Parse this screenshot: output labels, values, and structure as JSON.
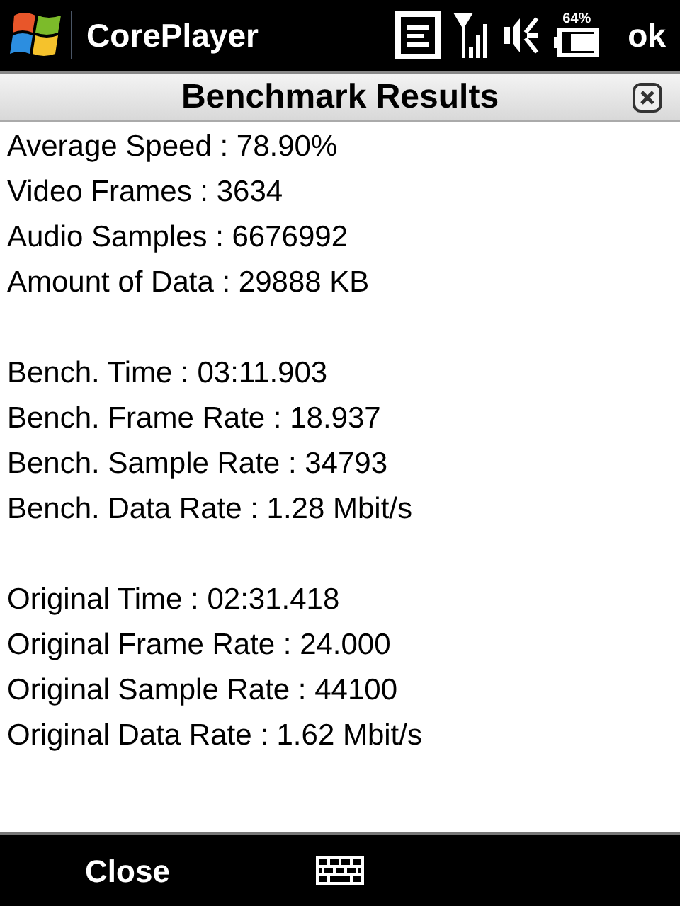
{
  "status_bar": {
    "app_title": "CorePlayer",
    "battery_label": "64%",
    "ok_button": "ok"
  },
  "dialog": {
    "title": "Benchmark Results"
  },
  "groups": [
    {
      "lines": [
        "Average Speed : 78.90%",
        "Video Frames : 3634",
        "Audio Samples : 6676992",
        "Amount of Data : 29888 KB"
      ]
    },
    {
      "lines": [
        "Bench. Time : 03:11.903",
        "Bench. Frame Rate : 18.937",
        "Bench. Sample Rate : 34793",
        "Bench. Data Rate : 1.28 Mbit/s"
      ]
    },
    {
      "lines": [
        "Original Time : 02:31.418",
        "Original Frame Rate : 24.000",
        "Original Sample Rate : 44100",
        "Original Data Rate : 1.62 Mbit/s"
      ]
    }
  ],
  "menu_bar": {
    "left_softkey": "Close"
  }
}
